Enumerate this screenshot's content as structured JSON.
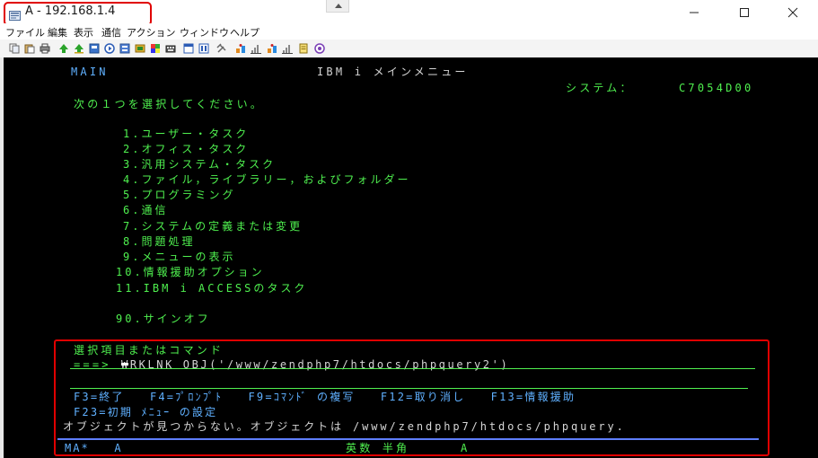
{
  "window": {
    "title": "A - 192.168.1.4"
  },
  "menubar": [
    "ファイル",
    "編集",
    "表示",
    "通信",
    "アクション",
    "ウィンドウ",
    "ヘルプ"
  ],
  "toolbar": {
    "icons": [
      "copy-icon",
      "paste-icon",
      "print-icon",
      "send-icon",
      "receive-icon",
      "record-icon",
      "play-icon",
      "settings-icon",
      "macro-icon",
      "color-icon",
      "keyboard-icon",
      "window-icon",
      "display-icon",
      "tools-icon",
      "transfer-icon",
      "chart-icon",
      "support-icon"
    ]
  },
  "screen": {
    "menu_id": "MAIN",
    "title": "IBM i メインメニュー",
    "system_label": "システム：",
    "system_name": "C7054D00",
    "prompt": "次の１つを選択してください。",
    "options": [
      "1.ユーザー・タスク",
      "2.オフィス・タスク",
      "3.汎用システム・タスク",
      "4.ファイル，ライブラリー，およびフォルダー",
      "5.プログラミング",
      "6.通信",
      "7.システムの定義または変更",
      "8.問題処理",
      "9.メニューの表示",
      "10.情報援助オプション",
      "11.IBM i ACCESSのタスク"
    ],
    "signoff": "90.サインオフ",
    "command_label": "選択項目またはコマンド",
    "command_prompt": "===>",
    "command_value": "WRKLNK OBJ('/www/zendphp7/htdocs/phpquery2')",
    "function_keys_1": "F3=終了   F4=ﾌﾟﾛﾝﾌﾟﾄ   F9=ｺﾏﾝﾄﾞ の複写   F12=取り消し   F13=情報援助",
    "function_keys_2": "F23=初期 ﾒﾆｭｰ の設定",
    "message": "オブジェクトが見つからない。オブジェクトは /www/zendphp7/htdocs/phpquery.",
    "status_left": "MA*   A",
    "status_middle": "英数 半角",
    "status_right": "A"
  }
}
